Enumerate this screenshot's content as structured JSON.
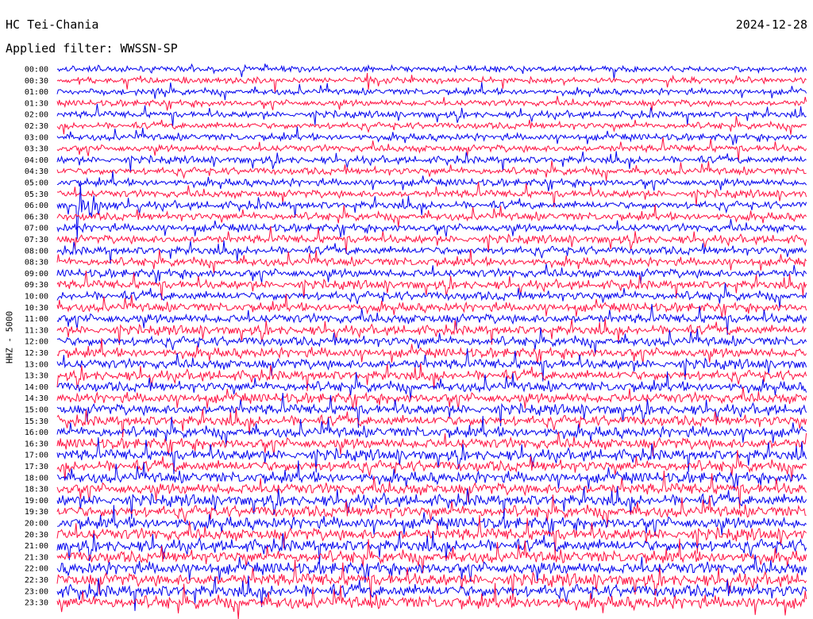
{
  "header": {
    "station": "HC Tei-Chania",
    "date": "2024-12-28",
    "filter_text": "Applied filter: WWSSN-SP",
    "channel_label": "HHZ - 5000"
  },
  "colors": {
    "trace_a": "#0000ee",
    "trace_b": "#ff1040",
    "background": "#ffffff",
    "text": "#000000"
  },
  "chart_data": {
    "type": "line",
    "title": "HC Tei-Chania",
    "ylabel": "HHZ - 5000",
    "y_tick_labels": [
      "00:00",
      "00:30",
      "01:00",
      "01:30",
      "02:00",
      "02:30",
      "03:00",
      "03:30",
      "04:00",
      "04:30",
      "05:00",
      "05:30",
      "06:00",
      "06:30",
      "07:00",
      "07:30",
      "08:00",
      "08:30",
      "09:00",
      "09:30",
      "10:00",
      "10:30",
      "11:00",
      "11:30",
      "12:00",
      "12:30",
      "13:00",
      "13:30",
      "14:00",
      "14:30",
      "15:00",
      "15:30",
      "16:00",
      "16:30",
      "17:00",
      "17:30",
      "18:00",
      "18:30",
      "19:00",
      "19:30",
      "20:00",
      "20:30",
      "21:00",
      "21:30",
      "22:00",
      "22:30",
      "23:00",
      "23:30"
    ],
    "series_colors": [
      "#0000ee",
      "#ff1040"
    ],
    "traces_per_row_minutes": 30,
    "events": [
      {
        "trace": "06:00",
        "position_fraction": 0.03,
        "note": "large amplitude event"
      }
    ]
  }
}
